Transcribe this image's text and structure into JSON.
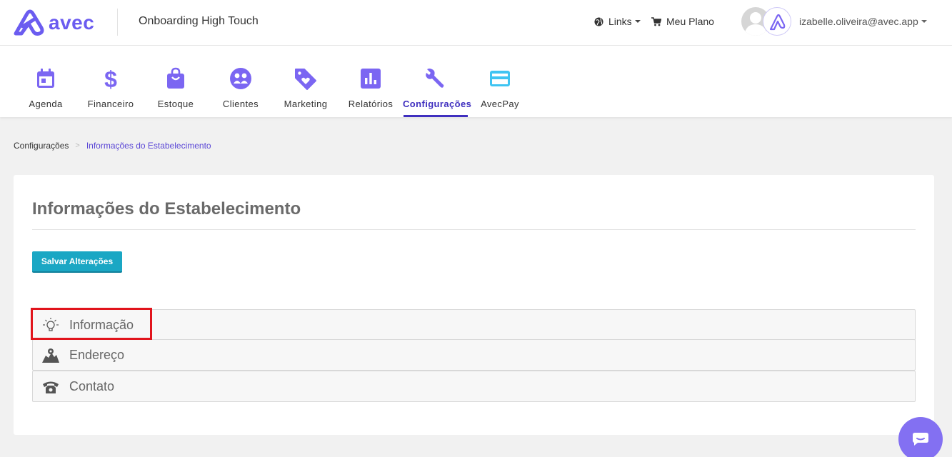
{
  "header": {
    "brand": "avec",
    "company": "Onboarding High Touch",
    "links_label": "Links",
    "plan_label": "Meu Plano",
    "user_email": "izabelle.oliveira@avec.app"
  },
  "nav": {
    "items": [
      {
        "label": "Agenda",
        "icon": "calendar-icon"
      },
      {
        "label": "Financeiro",
        "icon": "dollar-icon"
      },
      {
        "label": "Estoque",
        "icon": "shopping-bag-icon"
      },
      {
        "label": "Clientes",
        "icon": "clients-icon"
      },
      {
        "label": "Marketing",
        "icon": "tag-heart-icon"
      },
      {
        "label": "Relatórios",
        "icon": "bar-chart-icon"
      },
      {
        "label": "Configurações",
        "icon": "wrench-icon"
      },
      {
        "label": "AvecPay",
        "icon": "credit-card-icon"
      }
    ],
    "active": "Configurações"
  },
  "breadcrumb": {
    "parent": "Configurações",
    "separator": ">",
    "current": "Informações do Estabelecimento"
  },
  "card": {
    "title": "Informações do Estabelecimento",
    "save_label": "Salvar Alterações",
    "sections": [
      {
        "label": "Informação",
        "icon": "lightbulb-icon"
      },
      {
        "label": "Endereço",
        "icon": "map-icon"
      },
      {
        "label": "Contato",
        "icon": "phone-icon"
      }
    ]
  },
  "colors": {
    "brand": "#6b5cf0",
    "nav_icon": "#7b66f2",
    "active_nav": "#3f2fbf",
    "save_button": "#1aa7c4",
    "highlight": "#e1141c",
    "chat": "#8370f2"
  }
}
